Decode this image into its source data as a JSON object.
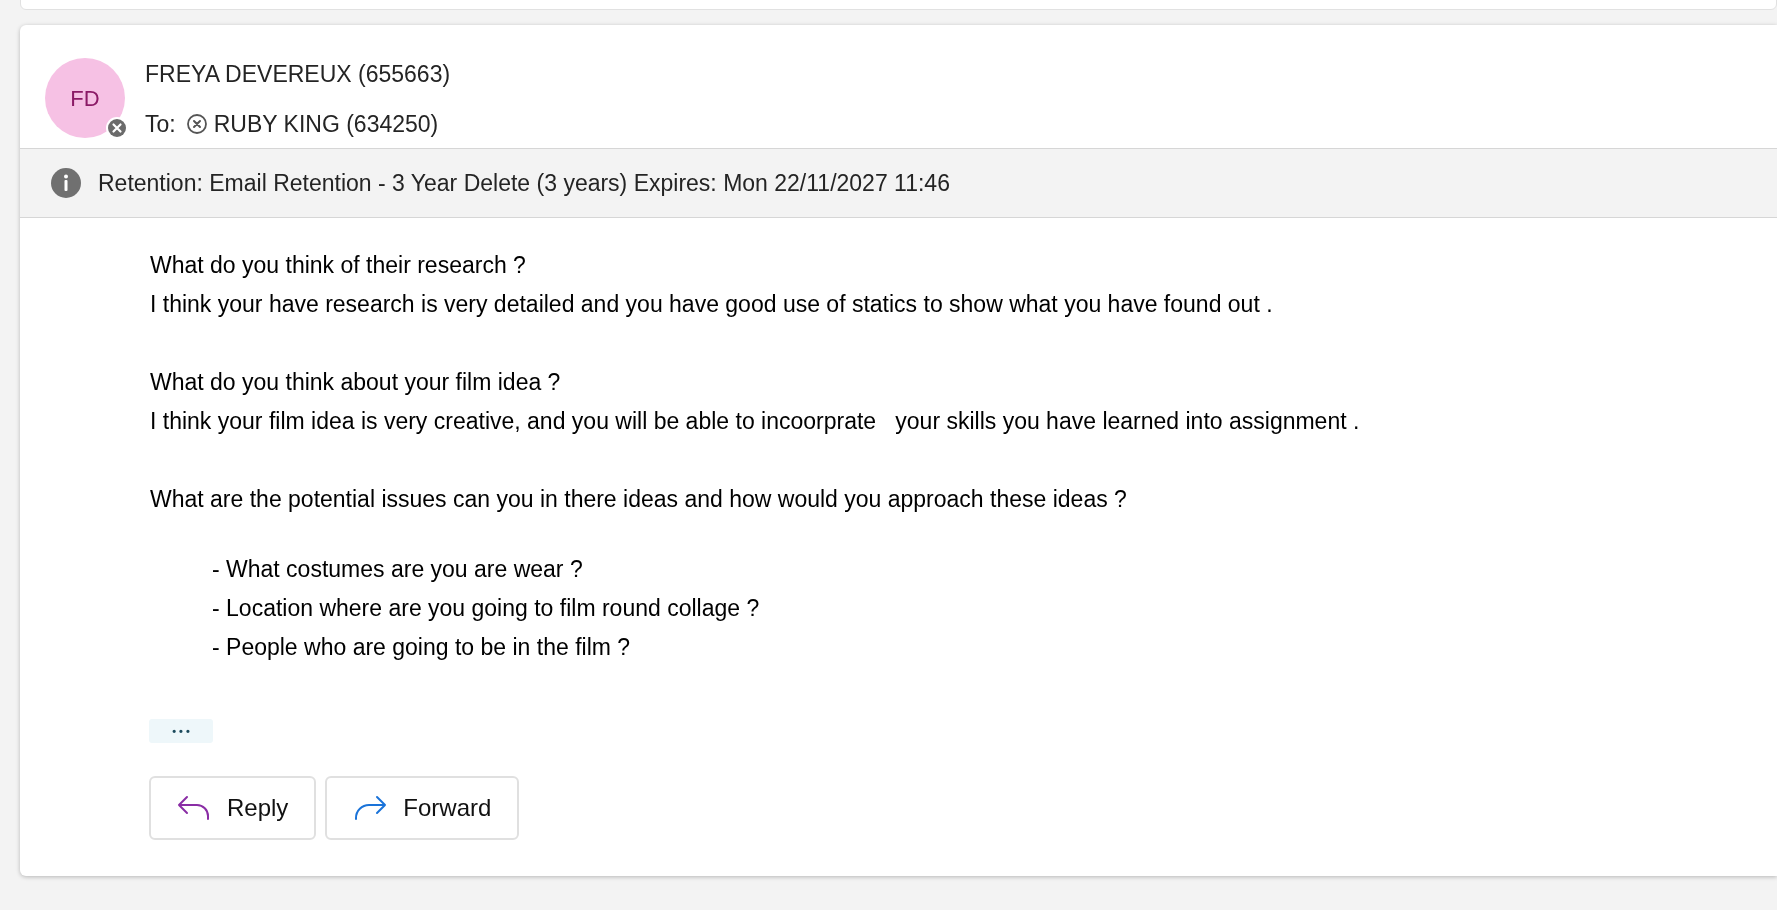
{
  "message": {
    "avatar": {
      "initials": "FD"
    },
    "sender": "FREYA DEVEREUX (655663)",
    "to_label": "To:",
    "recipients": [
      "RUBY KING (634250)"
    ],
    "retention": "Retention: Email Retention - 3 Year Delete (3 years) Expires: Mon 22/11/2027 11:46",
    "body": [
      {
        "kind": "text",
        "lines": [
          "What do you think of their research ?",
          "I think your have research is very detailed and you have good use of statics to show what you have found out ."
        ]
      },
      {
        "kind": "text",
        "lines": [
          "What do you think about your film idea ?",
          "I think your film idea is very creative, and you will be able to incoorprate   your skills you have learned into assignment ."
        ]
      },
      {
        "kind": "text",
        "lines": [
          "What are the potential issues can you in there ideas and how would you approach these ideas ?"
        ]
      },
      {
        "kind": "list",
        "lines": [
          "- What costumes are you are wear ?",
          "- Location where are you going to film round collage ?",
          "- People who are going to be in the film ?"
        ]
      }
    ],
    "expand_label": "• • •",
    "actions": [
      {
        "kind": "reply",
        "label": "Reply"
      },
      {
        "kind": "forward",
        "label": "Forward"
      }
    ]
  }
}
